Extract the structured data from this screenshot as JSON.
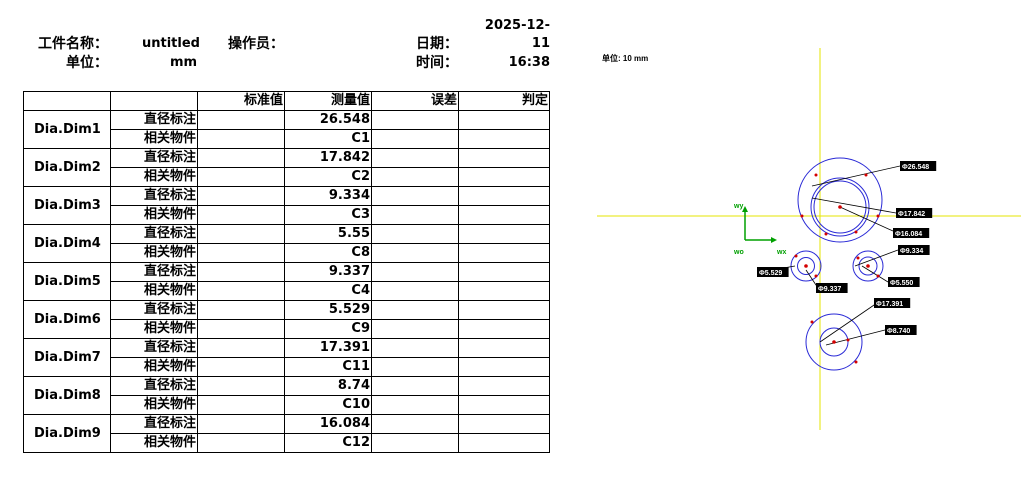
{
  "header": {
    "job_name_label": "工件名称：",
    "job_name_value": "untitled",
    "unit_label": "单位：",
    "unit_value": "mm",
    "operator_label": "操作员：",
    "date_label": "日期：",
    "date_value_line1": "2025-12-",
    "date_value_line2": "11",
    "time_label": "时间：",
    "time_value": "16:38"
  },
  "table": {
    "columns": [
      "",
      "",
      "标准值",
      "测量值",
      "误差",
      "判定"
    ],
    "row_labels": {
      "diameter": "直径标注",
      "related": "相关物件"
    },
    "rows": [
      {
        "name": "Dia.Dim1",
        "measured": "26.548",
        "object": "C1"
      },
      {
        "name": "Dia.Dim2",
        "measured": "17.842",
        "object": "C2"
      },
      {
        "name": "Dia.Dim3",
        "measured": "9.334",
        "object": "C3"
      },
      {
        "name": "Dia.Dim4",
        "measured": "5.55",
        "object": "C8"
      },
      {
        "name": "Dia.Dim5",
        "measured": "9.337",
        "object": "C4"
      },
      {
        "name": "Dia.Dim6",
        "measured": "5.529",
        "object": "C9"
      },
      {
        "name": "Dia.Dim7",
        "measured": "17.391",
        "object": "C11"
      },
      {
        "name": "Dia.Dim8",
        "measured": "8.74",
        "object": "C10"
      },
      {
        "name": "Dia.Dim9",
        "measured": "16.084",
        "object": "C12"
      }
    ]
  },
  "drawing": {
    "scale_label": "单位: 10 mm",
    "axis_y_label": "wy",
    "axis_x_label": "wx",
    "origin_label": "wo",
    "dims": [
      "Φ26.548",
      "Φ17.842",
      "Φ16.084",
      "Φ9.334",
      "Φ5.529",
      "Φ5.550",
      "Φ9.337",
      "Φ17.391",
      "Φ8.740"
    ],
    "colors": {
      "crosshair": "#e6e600",
      "circle": "#2a2ad6",
      "marker": "#d40000",
      "axis": "#00a000",
      "label_bg": "#000000",
      "label_fg": "#ffffff"
    }
  }
}
